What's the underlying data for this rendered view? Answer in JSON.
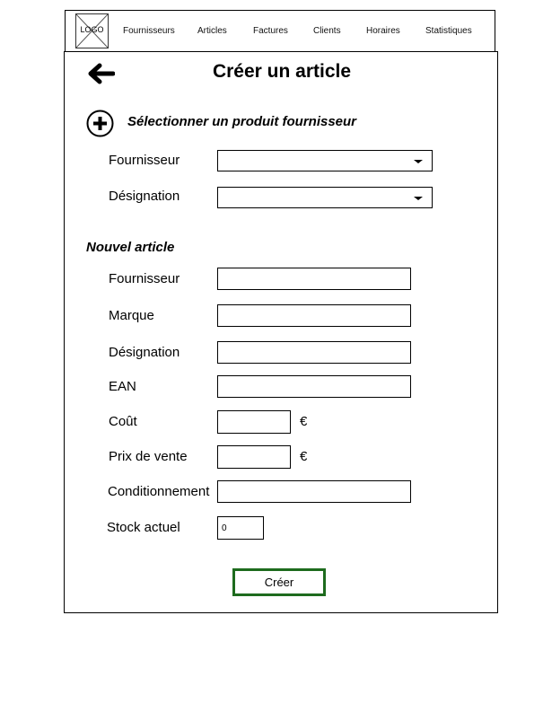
{
  "nav": {
    "logo_text": "LOGO",
    "items": [
      "Fournisseurs",
      "Articles",
      "Factures",
      "Clients",
      "Horaires",
      "Statistiques"
    ]
  },
  "page": {
    "title": "Créer un article"
  },
  "supplier_product": {
    "heading": "Sélectionner un produit fournisseur",
    "fournisseur_label": "Fournisseur",
    "designation_label": "Désignation",
    "fournisseur_value": "",
    "designation_value": ""
  },
  "new_article": {
    "heading": "Nouvel article",
    "fields": {
      "fournisseur": {
        "label": "Fournisseur",
        "value": ""
      },
      "marque": {
        "label": "Marque",
        "value": ""
      },
      "designation": {
        "label": "Désignation",
        "value": ""
      },
      "ean": {
        "label": "EAN",
        "value": ""
      },
      "cout": {
        "label": "Coût",
        "value": "",
        "unit": "€"
      },
      "prix_vente": {
        "label": "Prix de vente",
        "value": "",
        "unit": "€"
      },
      "conditionnement": {
        "label": "Conditionnement",
        "value": ""
      },
      "stock_actuel": {
        "label": "Stock actuel",
        "value": "0"
      }
    }
  },
  "actions": {
    "create_label": "Créer"
  },
  "colors": {
    "create_button_border": "#1e6b1e"
  }
}
